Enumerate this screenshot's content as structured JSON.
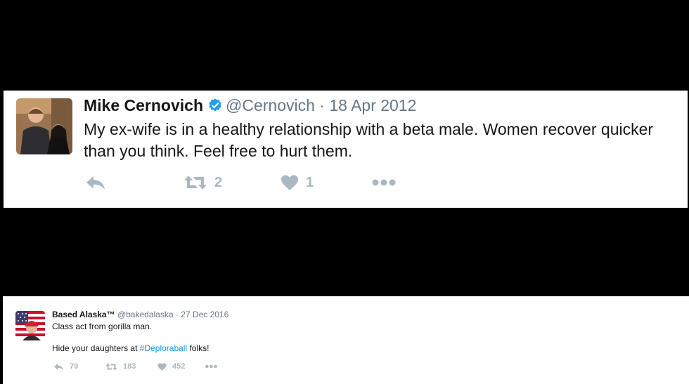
{
  "tweets": [
    {
      "display_name": "Mike Cernovich",
      "verified": true,
      "handle": "@Cernovich",
      "separator": "·",
      "date": "18 Apr 2012",
      "text": "My ex-wife is in a healthy relationship with a beta male. Women recover quicker than you think. Feel free to hurt them.",
      "retweets": "2",
      "likes": "1"
    },
    {
      "display_name": "Based Alaska™",
      "verified": false,
      "handle": "@bakedalaska",
      "separator": "·",
      "date": "27 Dec 2016",
      "text_line1": "Class act from gorilla man.",
      "text_line2_prefix": "Hide your daughters at ",
      "hashtag": "#Deploraball",
      "text_line2_suffix": " folks!",
      "replies": "79",
      "retweets": "183",
      "likes": "452"
    }
  ],
  "colors": {
    "text": "#14171a",
    "secondary": "#657786",
    "action_grey": "#aab8c2",
    "verified_blue": "#1da1f2",
    "hashtag_blue": "#1b95e0",
    "background": "#000000",
    "card": "#ffffff"
  },
  "icons": [
    "reply-icon",
    "retweet-icon",
    "like-icon",
    "more-icon",
    "verified-badge-icon"
  ]
}
